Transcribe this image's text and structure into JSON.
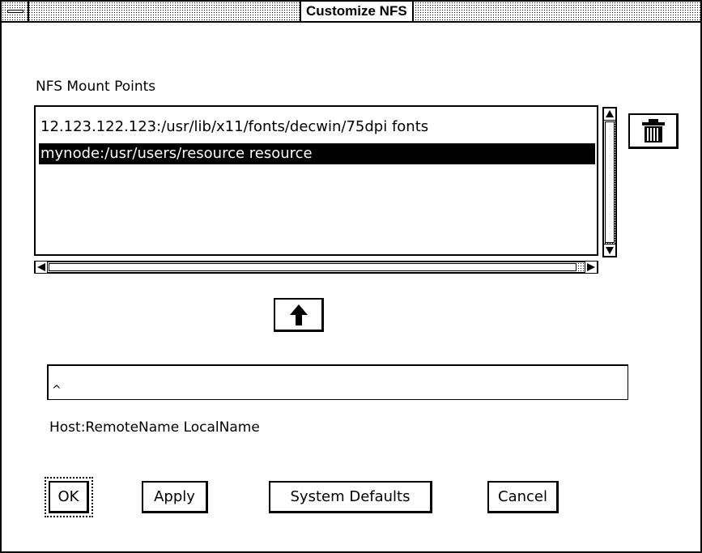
{
  "window": {
    "title": "Customize NFS"
  },
  "mount_points": {
    "label": "NFS Mount Points",
    "items": [
      {
        "text": "12.123.122.123:/usr/lib/x11/fonts/decwin/75dpi  fonts",
        "selected": false
      },
      {
        "text": "mynode:/usr/users/resource  resource",
        "selected": true
      }
    ]
  },
  "icons": {
    "delete": "trash-can-icon",
    "add": "up-arrow-icon",
    "scroll_up": "scroll-up-arrow-icon",
    "scroll_down": "scroll-down-arrow-icon",
    "scroll_left": "scroll-left-arrow-icon",
    "scroll_right": "scroll-right-arrow-icon"
  },
  "entry": {
    "value": "",
    "hint": "Host:RemoteName LocalName"
  },
  "buttons": {
    "ok": "OK",
    "apply": "Apply",
    "system_defaults": "System Defaults",
    "cancel": "Cancel"
  }
}
